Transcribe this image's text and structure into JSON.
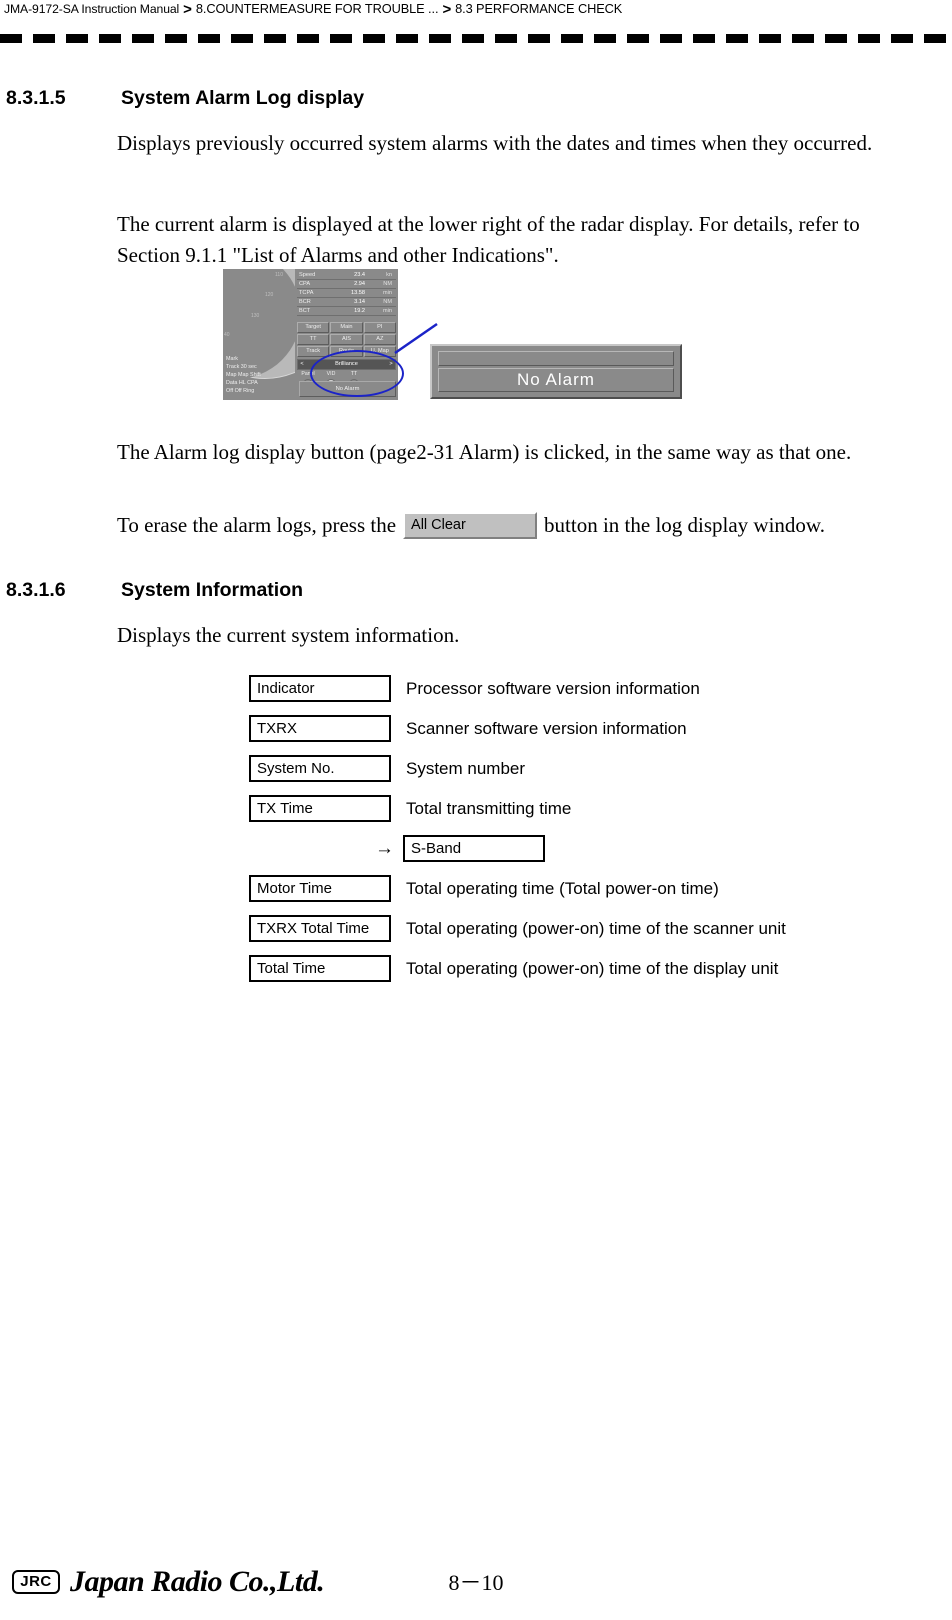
{
  "header": {
    "manual": "JMA-9172-SA Instruction Manual",
    "separator": ">",
    "chapter": "8.COUNTERMEASURE FOR TROUBLE ...",
    "section": "8.3  PERFORMANCE CHECK"
  },
  "sections": [
    {
      "number": "8.3.1.5",
      "title": "System Alarm Log display",
      "paragraphs": [
        "Displays previously occurred system alarms with the dates and times when they occurred.",
        "The current alarm is displayed at the lower right of the radar display. For details, refer to Section 9.1.1 \"List of Alarms and other Indications\".",
        "The Alarm log display button (page2-31 Alarm) is clicked, in the same way as that one."
      ],
      "inline_sentence": {
        "before": "To erase the alarm logs, press the",
        "button_label": "All Clear",
        "after": "button in the log display window."
      }
    },
    {
      "number": "8.3.1.6",
      "title": "System Information",
      "paragraphs": [
        "Displays the current system information."
      ]
    }
  ],
  "radar_figure": {
    "range_labels": [
      "110",
      "120",
      "130",
      "40"
    ],
    "data_rows": [
      {
        "label": "Speed",
        "value": "23.4",
        "unit": "kn"
      },
      {
        "label": "CPA",
        "value": "2.94",
        "unit": "NM"
      },
      {
        "label": "TCPA",
        "value": "13.58",
        "unit": "min"
      },
      {
        "label": "BCR",
        "value": "3.14",
        "unit": "NM"
      },
      {
        "label": "BCT",
        "value": "19.2",
        "unit": "min"
      }
    ],
    "button_rows": [
      [
        "Target",
        "Main",
        "PI"
      ],
      [
        "TT",
        "AIS",
        "AZ"
      ],
      [
        "Track",
        "Route",
        "U. Map"
      ]
    ],
    "brilliance": {
      "left_arrow": "<",
      "title": "Brilliance",
      "right_arrow": ">"
    },
    "knob_labels": [
      "Panel",
      "VID",
      "TT",
      "DATA"
    ],
    "left_menu": [
      "Mark",
      "Track   30  sec",
      "Map  Map  Shift",
      "Data    HL    CPA",
      "Off     Off    Ring"
    ],
    "status_strip": "No  Alarm"
  },
  "noalarm_panel": {
    "text": "No  Alarm"
  },
  "system_info": {
    "rows": [
      {
        "box": "Indicator",
        "desc": "Processor software version information"
      },
      {
        "box": "TXRX",
        "desc": "Scanner software version information"
      },
      {
        "box": "System No.",
        "desc": "System number"
      },
      {
        "box": "TX Time",
        "desc": "Total transmitting time"
      }
    ],
    "sub_row": {
      "arrow": "→",
      "box": "S-Band"
    },
    "rows_after": [
      {
        "box": "Motor Time",
        "desc": "Total operating time (Total power-on time)"
      },
      {
        "box": "TXRX Total Time",
        "desc": "Total operating (power-on) time of the scanner unit"
      },
      {
        "box": "Total Time",
        "desc": "Total operating (power-on) time of the display unit"
      }
    ]
  },
  "footer": {
    "logo_mark": "JRC",
    "company": "Japan Radio Co.,Ltd.",
    "page": "8－10"
  }
}
